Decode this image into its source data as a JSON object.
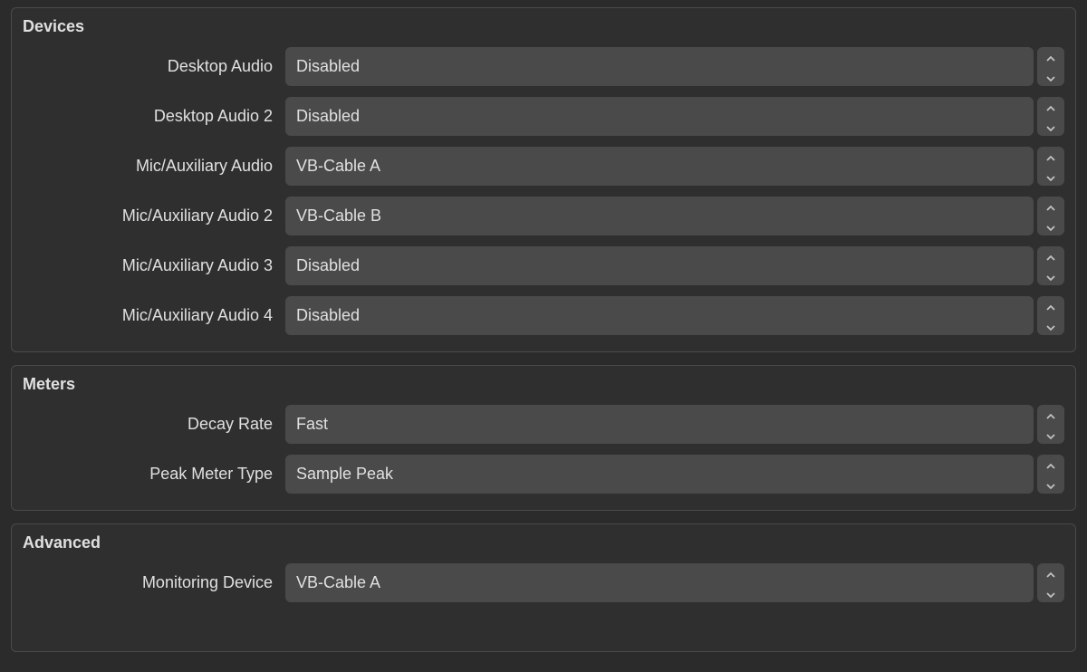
{
  "devices": {
    "title": "Devices",
    "rows": [
      {
        "label": "Desktop Audio",
        "value": "Disabled"
      },
      {
        "label": "Desktop Audio 2",
        "value": "Disabled"
      },
      {
        "label": "Mic/Auxiliary Audio",
        "value": "VB-Cable A"
      },
      {
        "label": "Mic/Auxiliary Audio 2",
        "value": "VB-Cable B"
      },
      {
        "label": "Mic/Auxiliary Audio 3",
        "value": "Disabled"
      },
      {
        "label": "Mic/Auxiliary Audio 4",
        "value": "Disabled"
      }
    ]
  },
  "meters": {
    "title": "Meters",
    "rows": [
      {
        "label": "Decay Rate",
        "value": "Fast"
      },
      {
        "label": "Peak Meter Type",
        "value": "Sample Peak"
      }
    ]
  },
  "advanced": {
    "title": "Advanced",
    "rows": [
      {
        "label": "Monitoring Device",
        "value": "VB-Cable A"
      }
    ]
  }
}
